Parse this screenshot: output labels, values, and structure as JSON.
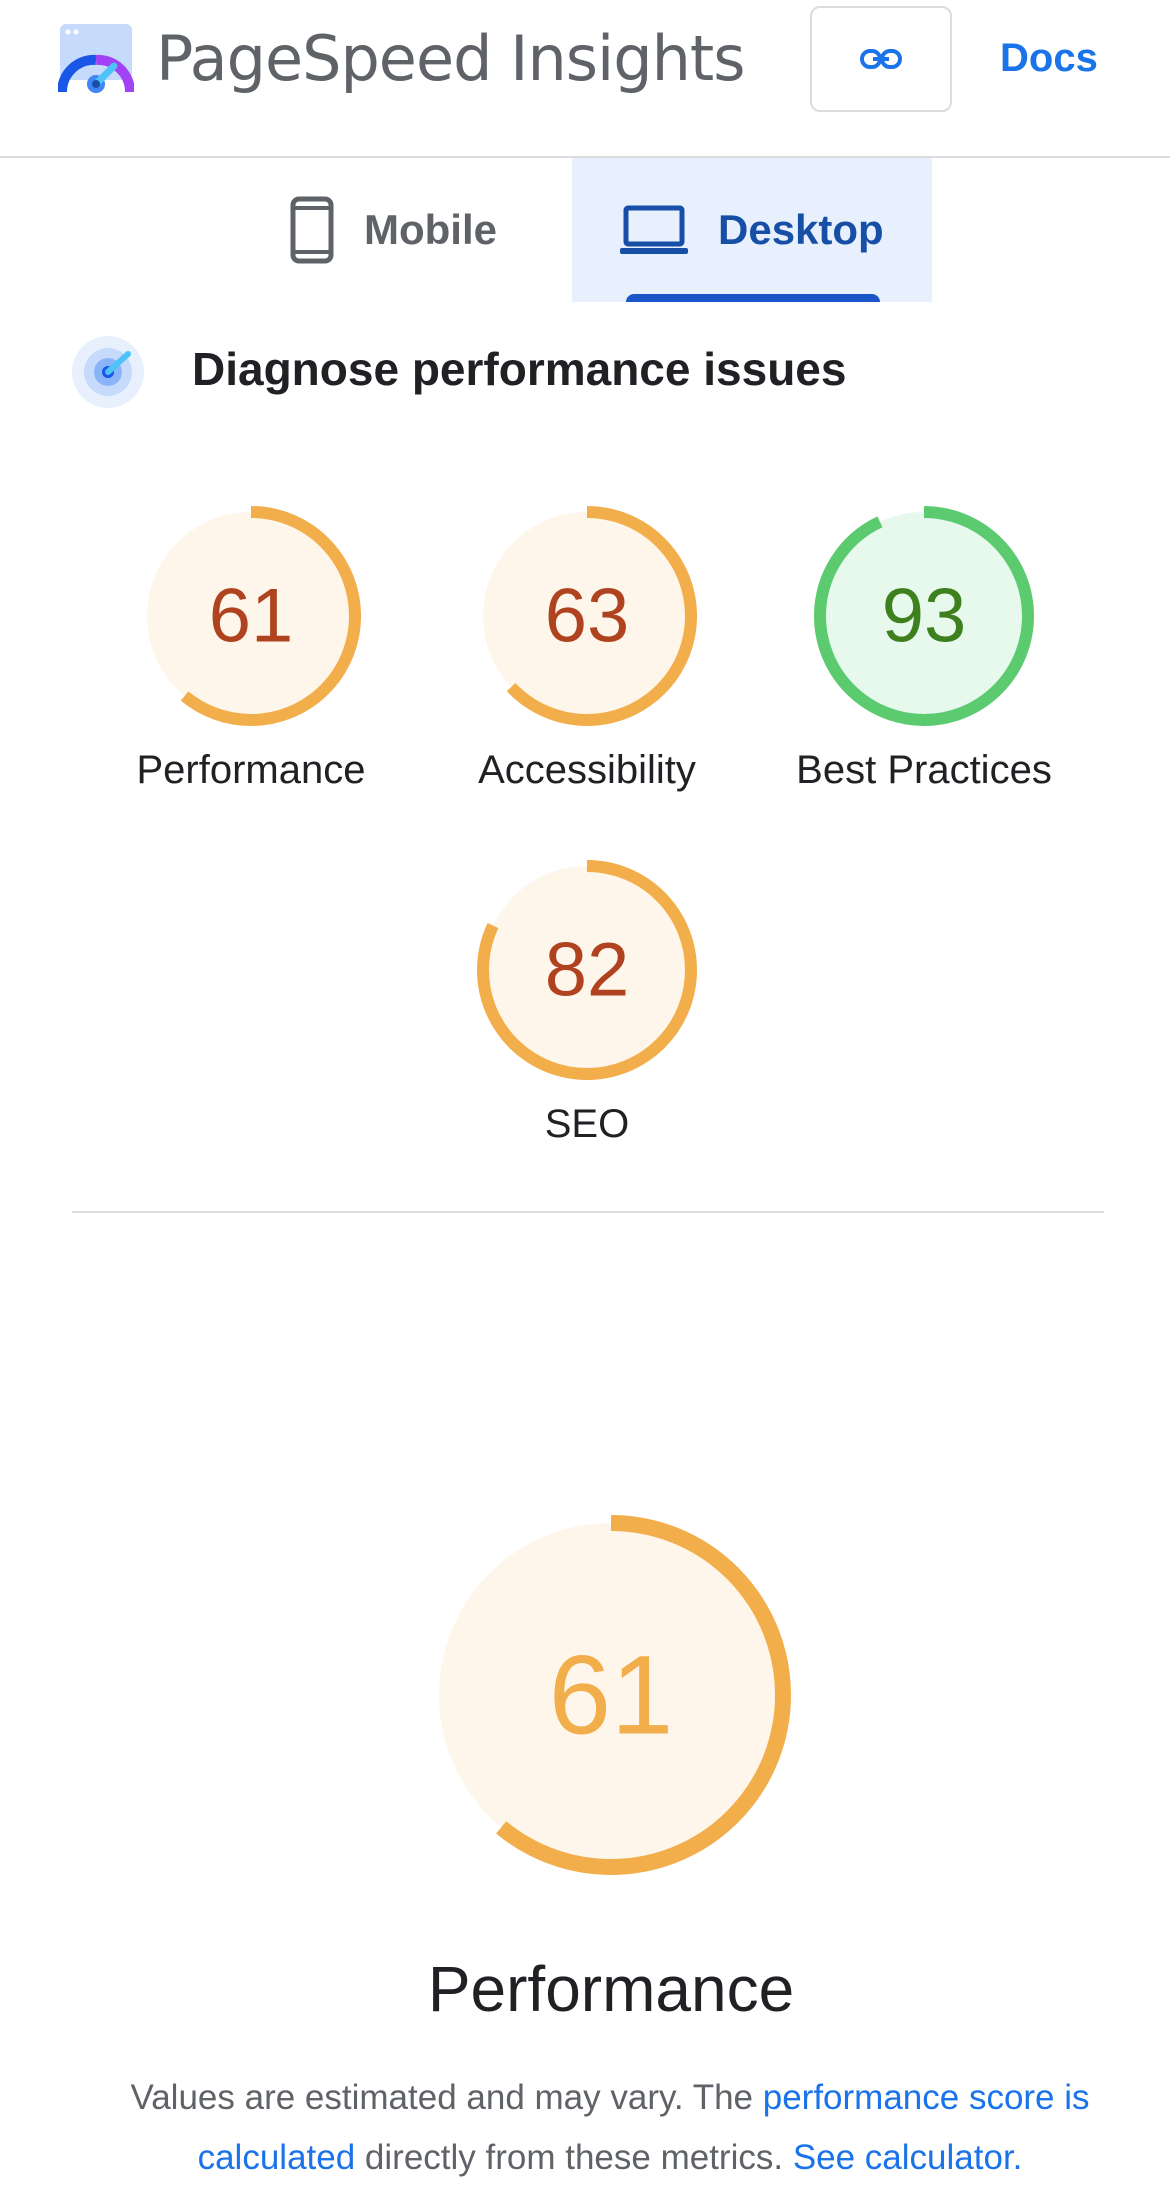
{
  "header": {
    "app_title": "PageSpeed Insights",
    "docs_label": "Docs",
    "link_icon": "link-icon",
    "accent_color": "#1a73e8"
  },
  "tabs": [
    {
      "label": "Mobile",
      "icon": "phone-icon",
      "selected": false
    },
    {
      "label": "Desktop",
      "icon": "laptop-icon",
      "selected": true
    }
  ],
  "diagnose": {
    "title": "Diagnose performance issues",
    "icon": "speedometer-target-icon"
  },
  "scores": [
    {
      "label": "Performance",
      "value": 61,
      "status": "average"
    },
    {
      "label": "Accessibility",
      "value": 63,
      "status": "average"
    },
    {
      "label": "Best Practices",
      "value": 93,
      "status": "pass"
    },
    {
      "label": "SEO",
      "value": 82,
      "status": "average"
    }
  ],
  "status_colors": {
    "average": {
      "ring": "#f2ae4b",
      "text": "#b0431f",
      "fill": "#fef6eb"
    },
    "pass": {
      "ring": "#5ccb70",
      "text": "#3e7f1e",
      "fill": "#e7f8ec"
    }
  },
  "performance_detail": {
    "value": 61,
    "title": "Performance",
    "text_color": "#f2ae4b",
    "description_prefix": "Values are estimated and may vary. The ",
    "description_link1": "performance score is calculated",
    "description_middle": " directly from these metrics. ",
    "description_link2": "See calculator."
  }
}
